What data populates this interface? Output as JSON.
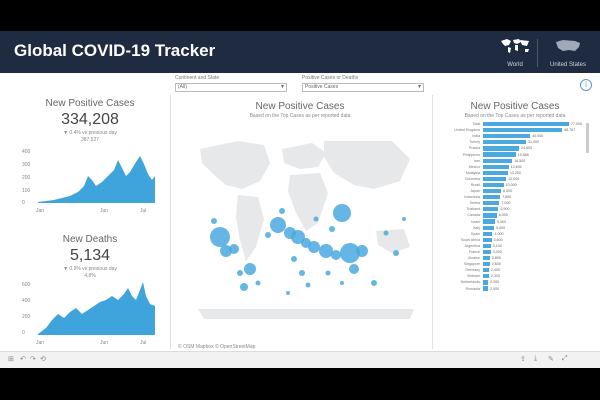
{
  "header": {
    "title": "Global COVID-19 Tracker",
    "world_label": "World",
    "us_label": "United States"
  },
  "filters": {
    "f1_label": "Continent and State",
    "f1_value": "(All)",
    "f2_label": "Positive Cases or Deaths",
    "f2_value": "Positive Cases"
  },
  "left": {
    "cases_title": "New Positive Cases",
    "cases_value": "334,208",
    "cases_sub1": "▼ 0.4% vs previous day",
    "cases_sub2": "387,527",
    "deaths_title": "New Deaths",
    "deaths_value": "5,134",
    "deaths_sub1": "▼ 0.9% vs previous day",
    "deaths_sub2": "4,8%",
    "chart1_y": [
      "400",
      "300",
      "200",
      "100",
      "0"
    ],
    "chart1_x": [
      "Jan",
      "Jun",
      "Jul"
    ],
    "chart2_y": [
      "600",
      "400",
      "200",
      "0"
    ],
    "chart2_x": [
      "Jan",
      "Jun",
      "Jul"
    ]
  },
  "map_panel": {
    "title": "New Positive Cases",
    "subtitle": "Based on the Top Cases as per reported data",
    "footnote": "© OSM Mapbox © OpenStreetMap"
  },
  "countries_panel": {
    "title": "New Positive Cases",
    "subtitle": "Based on the Top Cases as per reported data",
    "rows": [
      {
        "name": "Total",
        "value": "77,000",
        "pct": 1.0
      },
      {
        "name": "United Kingdom",
        "value": "68,767",
        "pct": 0.92
      },
      {
        "name": "India",
        "value": "40,000",
        "pct": 0.55
      },
      {
        "name": "Turkey",
        "value": "31,000",
        "pct": 0.5
      },
      {
        "name": "Russia",
        "value": "24,600",
        "pct": 0.42
      },
      {
        "name": "Philippines",
        "value": "19,568",
        "pct": 0.38
      },
      {
        "name": "Iran",
        "value": "16,500",
        "pct": 0.34
      },
      {
        "name": "Mexico",
        "value": "13,600",
        "pct": 0.3
      },
      {
        "name": "Malaysia",
        "value": "13,200",
        "pct": 0.29
      },
      {
        "name": "Colombia",
        "value": "12,000",
        "pct": 0.27
      },
      {
        "name": "Brazil",
        "value": "10,000",
        "pct": 0.24
      },
      {
        "name": "Japan",
        "value": "8,000",
        "pct": 0.21
      },
      {
        "name": "Indonesia",
        "value": "7,800",
        "pct": 0.2
      },
      {
        "name": "Serbia",
        "value": "7,000",
        "pct": 0.19
      },
      {
        "name": "Thailand",
        "value": "6,900",
        "pct": 0.18
      },
      {
        "name": "Canada",
        "value": "6,000",
        "pct": 0.16
      },
      {
        "name": "Israel",
        "value": "5,000",
        "pct": 0.14
      },
      {
        "name": "Italy",
        "value": "5,000",
        "pct": 0.13
      },
      {
        "name": "Spain",
        "value": "4,000",
        "pct": 0.11
      },
      {
        "name": "South Africa",
        "value": "3,600",
        "pct": 0.1
      },
      {
        "name": "Argentina",
        "value": "3,100",
        "pct": 0.09
      },
      {
        "name": "France",
        "value": "3,000",
        "pct": 0.09
      },
      {
        "name": "Ukraine",
        "value": "2,800",
        "pct": 0.08
      },
      {
        "name": "Singapore",
        "value": "2,600",
        "pct": 0.08
      },
      {
        "name": "Germany",
        "value": "2,400",
        "pct": 0.07
      },
      {
        "name": "Vietnam",
        "value": "2,300",
        "pct": 0.07
      },
      {
        "name": "Netherlands",
        "value": "2,200",
        "pct": 0.06
      },
      {
        "name": "Romania",
        "value": "2,000",
        "pct": 0.06
      }
    ]
  },
  "colors": {
    "header_bg": "#1e2b40",
    "accent": "#4aa9df",
    "area": "#3fa4dc"
  }
}
